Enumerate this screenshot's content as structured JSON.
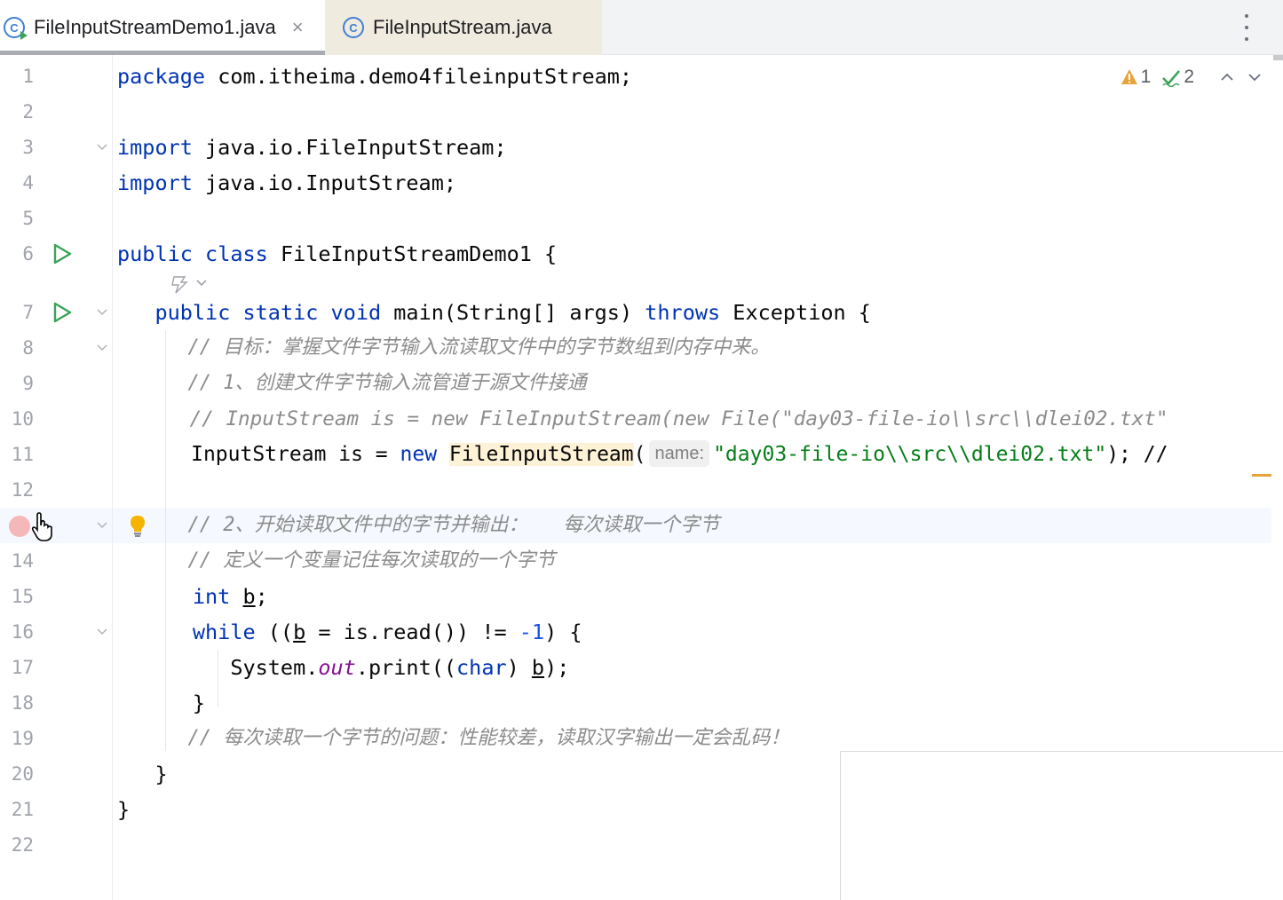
{
  "tabs": [
    {
      "label": "FileInputStreamDemo1.java",
      "active": true,
      "icon": "java-class-run-icon",
      "close": "×"
    },
    {
      "label": "FileInputStream.java",
      "active": false,
      "icon": "java-class-icon"
    }
  ],
  "tab_icon_letter": "C",
  "inspections": {
    "warnings": "1",
    "weak_warnings": "2"
  },
  "line_numbers": [
    "1",
    "2",
    "3",
    "4",
    "5",
    "6",
    "7",
    "8",
    "9",
    "10",
    "11",
    "12",
    "14",
    "15",
    "16",
    "17",
    "18",
    "19",
    "20",
    "21",
    "22"
  ],
  "code": {
    "l1": {
      "kw": "package",
      "rest": " com.itheima.demo4fileinputStream;"
    },
    "l3": {
      "kw": "import",
      "rest": " java.io.FileInputStream;"
    },
    "l4": {
      "kw": "import",
      "rest": " java.io.InputStream;"
    },
    "l6": {
      "kw1": "public",
      "kw2": "class",
      "rest": " FileInputStreamDemo1 {"
    },
    "l7": {
      "indent": "   ",
      "kw1": "public",
      "kw2": "static",
      "kw3": "void",
      "name": " main(String[] args) ",
      "kw4": "throws",
      "rest": " Exception {"
    },
    "l8": "      // 目标：掌握文件字节输入流读取文件中的字节数组到内存中来。",
    "l9": "      // 1、创建文件字节输入流管道于源文件接通",
    "l10": "      // InputStream is = new FileInputStream(new File(\"day03-file-io\\\\src\\\\dlei02.txt\"",
    "l11": {
      "indent": "      ",
      "type": "InputStream is = ",
      "kw": "new",
      "cls": "FileInputStream",
      "paren": "(",
      "hint": "name:",
      "str": "\"day03-file-io\\\\src\\\\dlei02.txt\"",
      "rest": "); //"
    },
    "l13": "      // 2、开始读取文件中的字节并输出：   每次读取一个字节",
    "l14": "      // 定义一个变量记住每次读取的一个字节",
    "l15": {
      "indent": "      ",
      "kw": "int",
      "sp": " ",
      "var": "b",
      "rest": ";"
    },
    "l16": {
      "indent": "      ",
      "kw": "while",
      "p1": " ((",
      "var": "b",
      "p2": " = is.read()) != ",
      "num": "-1",
      "rest": ") {"
    },
    "l17": {
      "indent": "         ",
      "sys": "System.",
      "fld": "out",
      "mid": ".print((",
      "kw": "char",
      "p": ") ",
      "var": "b",
      "rest": ");"
    },
    "l18": "      }",
    "l19": "      // 每次读取一个字节的问题：性能较差，读取汉字输出一定会乱码！",
    "l20": "   }",
    "l21": "}"
  }
}
